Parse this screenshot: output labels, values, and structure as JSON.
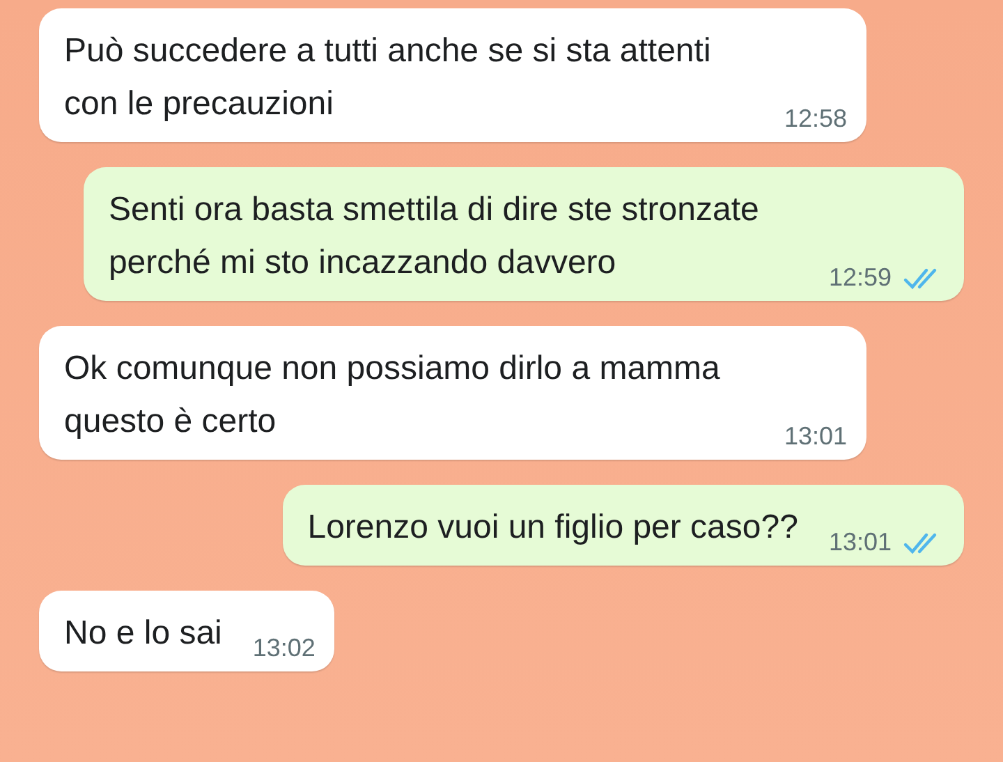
{
  "messages": [
    {
      "kind": "incoming",
      "text": "Può succedere a tutti anche se si sta attenti con le precauzioni",
      "time": "12:58"
    },
    {
      "kind": "outgoing",
      "text": "Senti ora basta smettila di dire ste stronzate perché mi sto incazzando davvero",
      "time": "12:59",
      "read": true
    },
    {
      "kind": "incoming",
      "text": "Ok comunque non possiamo dirlo a mamma questo è certo",
      "time": "13:01"
    },
    {
      "kind": "outgoing",
      "text": "Lorenzo vuoi un figlio per caso??",
      "time": "13:01",
      "read": true
    },
    {
      "kind": "incoming",
      "text": "No e lo sai",
      "time": "13:02"
    }
  ]
}
